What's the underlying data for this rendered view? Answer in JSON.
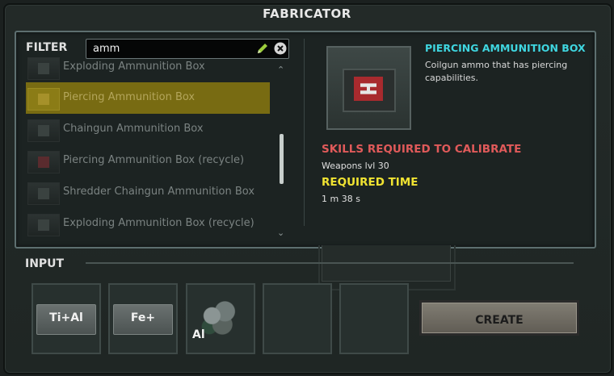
{
  "window": {
    "title": "FABRICATOR"
  },
  "filter": {
    "label": "FILTER",
    "search_value": "amm"
  },
  "icons": {
    "edit": "pencil-icon",
    "clear": "close-circle-icon",
    "up": "chevron-up-icon",
    "down": "chevron-down-icon"
  },
  "list": {
    "items": [
      {
        "label": "Exploding Ammunition Box",
        "selected": false
      },
      {
        "label": "Piercing Ammunition Box",
        "selected": true
      },
      {
        "label": "Chaingun Ammunition Box",
        "selected": false
      },
      {
        "label": "Piercing Ammunition Box (recycle)",
        "selected": false
      },
      {
        "label": "Shredder Chaingun Ammunition Box",
        "selected": false
      },
      {
        "label": "Exploding Ammunition Box (recycle)",
        "selected": false
      }
    ]
  },
  "details": {
    "name": "PIERCING AMMUNITION BOX",
    "description": "Coilgun ammo that has piercing capabilities.",
    "skills_heading": "SKILLS REQUIRED TO CALIBRATE",
    "skills_value": "Weapons lvl 30",
    "time_heading": "REQUIRED TIME",
    "time_value": "1 m 38 s"
  },
  "input": {
    "label": "INPUT",
    "slots": [
      {
        "text": "Ti+Al"
      },
      {
        "text": "Fe+"
      },
      {
        "text": "Al"
      },
      {
        "text": ""
      },
      {
        "text": ""
      }
    ]
  },
  "create_label": "CREATE",
  "colors": {
    "selected_row": "#786b12",
    "title_cyan": "#3fd6e0",
    "skills_red": "#e05a5a",
    "time_yellow": "#f0e332"
  }
}
